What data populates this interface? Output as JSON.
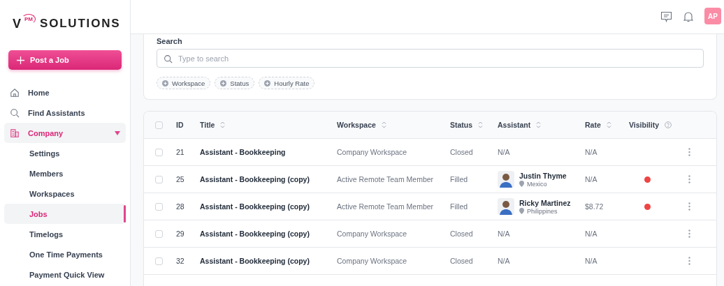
{
  "logo": {
    "mark": "V",
    "superscript": "PM",
    "word": "SOLUTIONS"
  },
  "post_button": {
    "label": "Post a Job"
  },
  "sidebar": {
    "items": [
      {
        "label": "Home",
        "selected": false
      },
      {
        "label": "Find Assistants",
        "selected": false
      },
      {
        "label": "Company",
        "selected": true,
        "expanded": true,
        "children": [
          {
            "label": "Settings",
            "selected": false
          },
          {
            "label": "Members",
            "selected": false
          },
          {
            "label": "Workspaces",
            "selected": false
          },
          {
            "label": "Jobs",
            "selected": true
          },
          {
            "label": "Timelogs",
            "selected": false
          },
          {
            "label": "One Time Payments",
            "selected": false
          },
          {
            "label": "Payment Quick View",
            "selected": false
          }
        ]
      }
    ]
  },
  "topbar": {
    "avatar": "AP"
  },
  "search": {
    "label": "Search",
    "placeholder": "Type to search",
    "filters": [
      "Workspace",
      "Status",
      "Hourly Rate"
    ]
  },
  "table": {
    "all_checked": false,
    "columns": [
      {
        "label": "ID",
        "sortable": false
      },
      {
        "label": "Title",
        "sortable": true
      },
      {
        "label": "Workspace",
        "sortable": true
      },
      {
        "label": "Status",
        "sortable": true
      },
      {
        "label": "Assistant",
        "sortable": true
      },
      {
        "label": "Rate",
        "sortable": true
      },
      {
        "label": "Visibility",
        "sortable": false,
        "help": true
      }
    ],
    "rows": [
      {
        "checked": false,
        "id": "21",
        "title": "Assistant - Bookkeeping",
        "workspace": "Company Workspace",
        "status": "Closed",
        "assistant": "N/A",
        "rate": "N/A",
        "visibility_dot": false
      },
      {
        "checked": false,
        "id": "25",
        "title": "Assistant - Bookkeeping (copy)",
        "workspace": "Active Remote Team Member",
        "status": "Filled",
        "assistant": {
          "name": "Justin Thyme",
          "location": "Mexico"
        },
        "rate": "N/A",
        "visibility_dot": true
      },
      {
        "checked": false,
        "id": "28",
        "title": "Assistant - Bookkeeping (copy)",
        "workspace": "Active Remote Team Member",
        "status": "Filled",
        "assistant": {
          "name": "Ricky Martinez",
          "location": "Philippines"
        },
        "rate": "$8.72",
        "visibility_dot": true
      },
      {
        "checked": false,
        "id": "29",
        "title": "Assistant - Bookkeeping (copy)",
        "workspace": "Company Workspace",
        "status": "Closed",
        "assistant": "N/A",
        "rate": "N/A",
        "visibility_dot": false
      },
      {
        "checked": false,
        "id": "32",
        "title": "Assistant - Bookkeeping (copy)",
        "workspace": "Company Workspace",
        "status": "Closed",
        "assistant": "N/A",
        "rate": "N/A",
        "visibility_dot": false
      }
    ]
  }
}
